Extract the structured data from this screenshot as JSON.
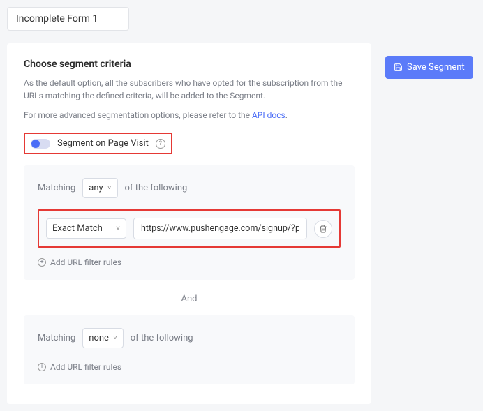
{
  "segment_name": "Incomplete Form 1",
  "section_title": "Choose segment criteria",
  "desc_main": "As the default option, all the subscribers who have opted for the subscription from the URLs matching the defined criteria, will be added to the Segment.",
  "desc_adv_prefix": "For more advanced segmentation options, please refer to the ",
  "api_docs_label": "API docs",
  "period": ".",
  "toggle_label": "Segment on Page Visit",
  "matching_label": "Matching",
  "of_following": "of the following",
  "any_label": "any",
  "none_label": "none",
  "filter_type": "Exact Match",
  "filter_url": "https://www.pushengage.com/signup/?planNan",
  "add_rule_label": "Add URL filter rules",
  "and_label": "And",
  "save_btn_label": "Save Segment"
}
